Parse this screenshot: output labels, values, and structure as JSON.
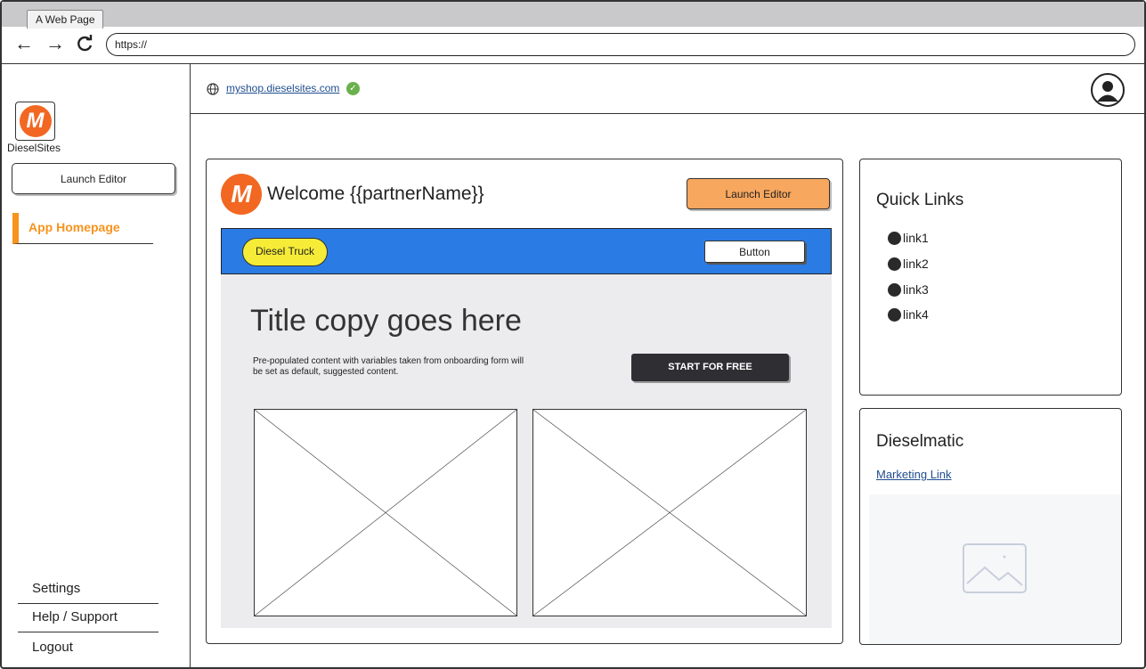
{
  "browser": {
    "tab_title": "A Web Page",
    "url": "https://"
  },
  "sidebar": {
    "brand_name": "DieselSites",
    "brand_mark": "M",
    "launch_editor_label": "Launch Editor",
    "active_item_label": "App Homepage",
    "bottom_items": [
      {
        "label": "Settings"
      },
      {
        "label": "Help / Support"
      },
      {
        "label": "Logout"
      }
    ]
  },
  "topbar": {
    "site_url": "myshop.dieselsites.com",
    "verified_icon": "check-circle-icon",
    "account_icon": "user-icon"
  },
  "main": {
    "logo_mark": "M",
    "welcome": "Welcome {{partnerName}}",
    "launch_editor_label": "Launch Editor",
    "preview": {
      "pill_label": "Diesel Truck",
      "header_button_label": "Button",
      "title": "Title copy goes here",
      "description": "Pre-populated content with variables taken from onboarding form will be set as default, suggested content.",
      "cta_label": "START FOR FREE"
    }
  },
  "quick_links": {
    "title": "Quick Links",
    "links": [
      {
        "label": "link1"
      },
      {
        "label": "link2"
      },
      {
        "label": "link3"
      },
      {
        "label": "link4"
      }
    ]
  },
  "dieselmatic": {
    "title": "Dieselmatic",
    "link_label": "Marketing Link",
    "image_icon": "image-placeholder-icon"
  },
  "colors": {
    "accent_orange": "#f7931e",
    "brand_orange": "#f26722",
    "button_orange": "#f7a75e",
    "hero_blue": "#2b7be5",
    "pill_yellow": "#f6ec37",
    "cta_dark": "#2f2f33",
    "link_blue": "#1f4d8f",
    "verified_green": "#6ab04c"
  }
}
